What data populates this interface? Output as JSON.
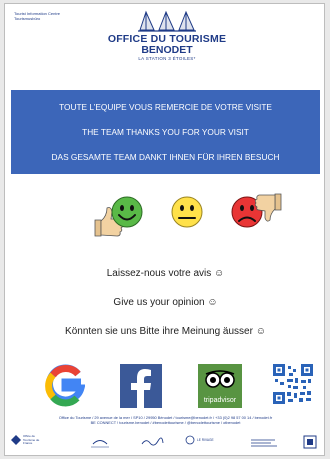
{
  "header": {
    "corner_line1": "Tourist Information Centre",
    "corner_line2": "Tourismusbüro",
    "logo_line1": "OFFICE DU TOURISME",
    "logo_line2": "BENODET",
    "logo_line3": "LA STATION 3 ÉTOILES*"
  },
  "banner": {
    "line_fr": "TOUTE L’EQUIPE VOUS REMERCIE DE VOTRE VISITE",
    "line_en": "THE TEAM THANKS YOU FOR YOUR VISIT",
    "line_de": "DAS GESAMTE TEAM DANKT IHNEN FÜR IHREN BESUCH",
    "color": "#3c66b9"
  },
  "faces": [
    {
      "mood": "happy",
      "color": "#59b947",
      "thumb": "up"
    },
    {
      "mood": "neutral",
      "color": "#ffe14a"
    },
    {
      "mood": "sad",
      "color": "#e93535",
      "thumb": "down"
    }
  ],
  "cta": {
    "fr": "Laissez-nous votre avis ☺",
    "en": "Give us your opinion ☺",
    "de": "Könnten sie uns Bitte ihre Meinung äusser ☺"
  },
  "logos": {
    "google_icon": "google-logo",
    "facebook_icon": "facebook-logo",
    "tripadvisor_label": "tripadvisor",
    "qr_icon": "qr-code"
  },
  "footer": {
    "address_line1": "Office du Tourisme  /  29 avenue de la mer  /  SP10  /  29950 Bénodet  /  tourisme@benodet.fr  /  +33 (0)2 98 57 00 14  /  benodet.fr",
    "address_line2": "BE CONNECT !  tourisme.benodet  /  #benodettourisme  /  @benodettourisme  /  otbenodet"
  },
  "partners": {
    "labels": [
      "Office de Tourisme de France",
      "",
      "",
      "LE RIVAGE",
      "",
      ""
    ]
  }
}
